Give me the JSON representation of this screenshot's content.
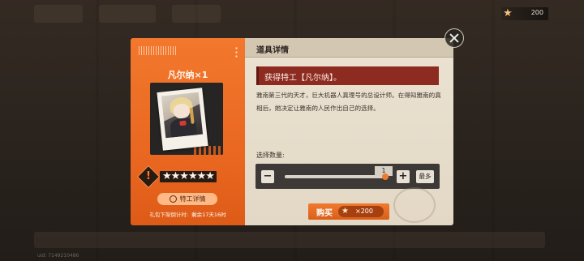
{
  "currency": {
    "icon": "star-icon",
    "amount": "200"
  },
  "item": {
    "name": "凡尔纳×1",
    "rarity_icon": "rarity-diamond-icon",
    "rarity_symbol": "!",
    "stars": "★★★★★★",
    "detail_button": "特工详情",
    "countdown_label": "礼包下架倒计时:",
    "countdown_value": "剩余17天16时"
  },
  "panel": {
    "title": "道具详情",
    "gain_text": "获得特工【凡尔纳】。",
    "description": "雅南第三代的天才，巨大机器人真理号的总设计师。在得知雅南的真相后，她决定让雅南的人民作出自己的选择。"
  },
  "quantity": {
    "label": "选择数量:",
    "minus": "−",
    "plus": "+",
    "max": "最多",
    "value": "1",
    "slider_level": 1.0
  },
  "purchase": {
    "label": "购买",
    "price": "×200",
    "price_icon": "star-icon"
  },
  "footer": {
    "uid": "uid: 7149210486"
  },
  "colors": {
    "accent": "#e8651f",
    "panel_bg": "#e6dccb",
    "gain_bar": "#8d2b20"
  }
}
